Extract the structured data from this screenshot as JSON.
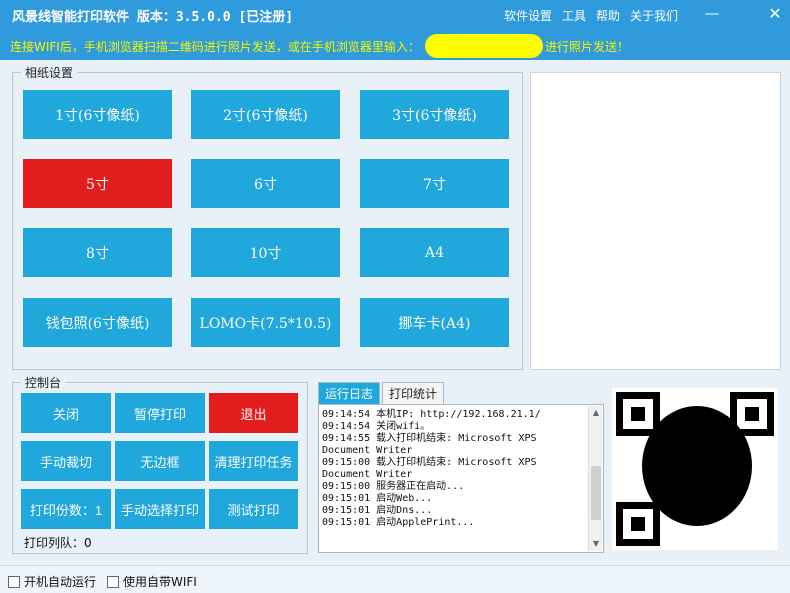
{
  "window": {
    "title": "风景线智能打印软件  版本：3.5.0.0 [已注册]",
    "menu": [
      "软件设置",
      "工具",
      "帮助",
      "关于我们"
    ],
    "min_glyph": "—",
    "close_glyph": "✕"
  },
  "info": {
    "left": "连接WIFI后，手机浏览器扫描二维码进行照片发送，或在手机浏览器里输入：",
    "right": "进行照片发送！"
  },
  "paper": {
    "title": "相纸设置",
    "buttons": [
      "1寸(6寸像纸)",
      "2寸(6寸像纸)",
      "3寸(6寸像纸)",
      "5寸",
      "6寸",
      "7寸",
      "8寸",
      "10寸",
      "A4",
      "钱包照(6寸像纸)",
      "LOMO卡(7.5*10.5)",
      "挪车卡(A4)"
    ],
    "selected_index": 3
  },
  "console": {
    "title": "控制台",
    "buttons": [
      "关闭",
      "暂停打印",
      "退出",
      "手动裁切",
      "无边框",
      "清理打印任务",
      "打印份数：1",
      "手动选择打印",
      "测试打印"
    ],
    "queue": "打印列队：0"
  },
  "log": {
    "tabs": [
      "运行日志",
      "打印统计"
    ],
    "active_tab": 0,
    "lines": "09:14:54 本机IP: http://192.168.21.1/\n09:14:54 关闭wifi。\n09:14:55 载入打印机结束: Microsoft XPS\nDocument Writer\n09:15:00 载入打印机结束: Microsoft XPS\nDocument Writer\n09:15:00 服务器正在启动...\n09:15:01 启动Web...\n09:15:01 启动Dns...\n09:15:01 启动ApplePrint..."
  },
  "bottom": {
    "autostart": "开机自动运行",
    "wifi": "使用自带WIFI"
  },
  "colors": {
    "accent": "#20a7dc",
    "selected": "#e11d1d",
    "info_text": "#f4f500"
  },
  "icons": {
    "minimize": "minimize-icon",
    "close": "close-icon"
  }
}
